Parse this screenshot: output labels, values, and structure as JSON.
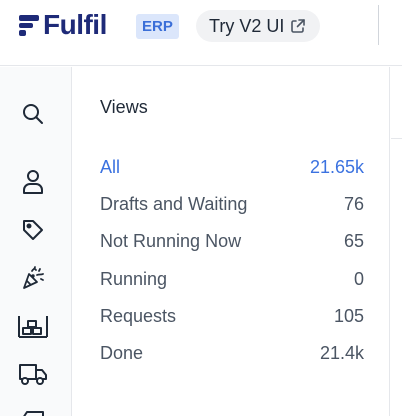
{
  "brand": {
    "name": "Fulfil",
    "badge": "ERP",
    "color": "#1e2a78"
  },
  "header": {
    "try_label": "Try V2 UI",
    "try_icon": "external-link-icon"
  },
  "rail": {
    "icons": [
      "search-icon",
      "user-icon",
      "tag-icon",
      "party-popper-icon",
      "warehouse-icon",
      "truck-icon",
      "box-icon"
    ]
  },
  "views": {
    "title": "Views",
    "accent": "#3b72e0",
    "items": [
      {
        "label": "All",
        "count": "21.65k",
        "active": true
      },
      {
        "label": "Drafts and Waiting",
        "count": "76"
      },
      {
        "label": "Not Running Now",
        "count": "65"
      },
      {
        "label": "Running",
        "count": "0"
      },
      {
        "label": "Requests",
        "count": "105"
      },
      {
        "label": "Done",
        "count": "21.4k"
      }
    ]
  }
}
